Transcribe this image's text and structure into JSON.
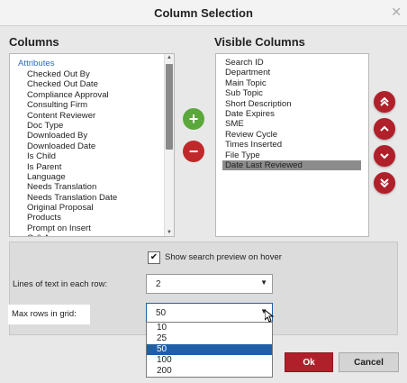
{
  "dialog": {
    "title": "Column Selection",
    "close_icon": "close-icon"
  },
  "columns": {
    "heading": "Columns",
    "group_label": "Attributes",
    "items": [
      "Checked Out By",
      "Checked Out Date",
      "Compliance Approval",
      "Consulting Firm",
      "Content Reviewer",
      "Doc Type",
      "Downloaded By",
      "Downloaded Date",
      "Is Child",
      "Is Parent",
      "Language",
      "Needs Translation",
      "Needs Translation Date",
      "Original Proposal",
      "Products",
      "Prompt on Insert",
      "Q & A"
    ]
  },
  "visible_columns": {
    "heading": "Visible Columns",
    "items": [
      "Search ID",
      "Department",
      "Main Topic",
      "Sub Topic",
      "Short Description",
      "Date Expires",
      "SME",
      "Review Cycle",
      "Times Inserted",
      "File Type",
      "Date Last Reviewed"
    ],
    "selected": "Date Last Reviewed"
  },
  "settings": {
    "show_preview_label": "Show search preview on hover",
    "show_preview_checked": true,
    "lines_label": "Lines of text in each row:",
    "lines_value": "2",
    "max_rows_label": "Max rows in grid:",
    "max_rows_value": "50",
    "max_rows_options": [
      "10",
      "25",
      "50",
      "100",
      "200"
    ],
    "max_rows_selected": "50"
  },
  "buttons": {
    "ok": "Ok",
    "cancel": "Cancel"
  },
  "colors": {
    "accent_red": "#b0202a",
    "add_green": "#5aa83c",
    "selected_blue": "#1f5fa8"
  }
}
